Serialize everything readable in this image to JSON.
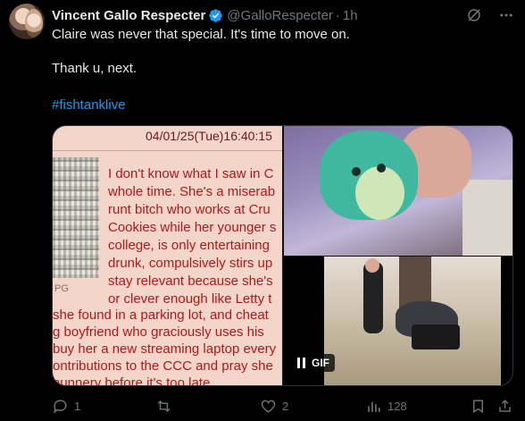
{
  "tweet": {
    "author_name": "Vincent Gallo Respecter",
    "handle": "@GalloRespecter",
    "separator": "·",
    "time": "1h",
    "text_line1": "Claire was never that special. It's time to move on.",
    "text_line2": "Thank u, next.",
    "hashtag": "#fishtanklive"
  },
  "media": {
    "doc_date": "04/01/25(Tue)16:40:15",
    "doc_pg": "PG",
    "doc_lines": [
      "I don't know what I saw in C",
      "whole time. She's a miserab",
      "runt bitch who works at Cru",
      "Cookies while her younger s",
      "college, is only entertaining",
      "drunk, compulsively stirs up",
      "stay relevant because she's",
      "or clever enough like Letty t",
      "she found in a parking lot, and cheat",
      "g boyfriend who graciously uses his",
      "buy her a new streaming laptop every",
      "ontributions to the CCC and pray she",
      "nunnery before it's too late."
    ],
    "gif_label": "GIF"
  },
  "actions": {
    "replies": "1",
    "reposts": "",
    "likes": "2",
    "views": "128"
  },
  "colors": {
    "accent": "#1d9bf0",
    "muted": "#71767b",
    "doc_text": "#b0181b"
  }
}
